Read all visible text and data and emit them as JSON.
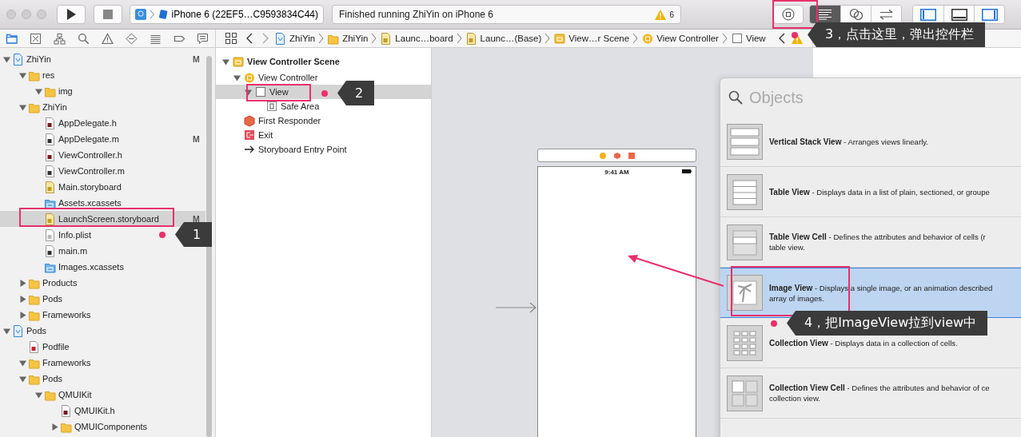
{
  "toolbar": {
    "scheme": "iPhone 6 (22EF5…C9593834C44)",
    "status": "Finished running ZhiYin on iPhone 6",
    "warning_count": "6",
    "editor_modes": [
      {
        "kind": "standard",
        "selected": true
      },
      {
        "kind": "assistant",
        "selected": false
      },
      {
        "kind": "version",
        "selected": false
      }
    ],
    "panels": [
      {
        "kind": "navigator",
        "on": true
      },
      {
        "kind": "debug",
        "on": false
      },
      {
        "kind": "inspector",
        "on": true
      }
    ]
  },
  "navigator_tabs": [
    {
      "kind": "project",
      "selected": true
    },
    {
      "kind": "symbol",
      "selected": false
    },
    {
      "kind": "hierarchy",
      "selected": false
    },
    {
      "kind": "search",
      "selected": false
    },
    {
      "kind": "issue",
      "selected": false
    },
    {
      "kind": "test",
      "selected": false
    },
    {
      "kind": "debug",
      "selected": false
    },
    {
      "kind": "breakpoint",
      "selected": false
    },
    {
      "kind": "report",
      "selected": false
    }
  ],
  "jump_bar": [
    {
      "kind": "project",
      "label": "ZhiYin"
    },
    {
      "kind": "folder",
      "label": "ZhiYin"
    },
    {
      "kind": "storyboard",
      "label": "Launc…board"
    },
    {
      "kind": "storyboard",
      "label": "Launc…(Base)"
    },
    {
      "kind": "scene",
      "label": "View…r Scene"
    },
    {
      "kind": "controller",
      "label": "View Controller"
    },
    {
      "kind": "view",
      "label": "View"
    }
  ],
  "navigator": {
    "tree": [
      {
        "kind": "project",
        "name": "ZhiYin",
        "badge": "M",
        "selected": false,
        "expanded": true,
        "children": [
          {
            "kind": "folder",
            "name": "res",
            "selected": false,
            "expanded": true,
            "children": [
              {
                "kind": "folder",
                "name": "img",
                "selected": false,
                "expanded": true
              }
            ]
          },
          {
            "kind": "folder",
            "name": "ZhiYin",
            "selected": false,
            "expanded": true,
            "children": [
              {
                "kind": "header",
                "name": "AppDelegate.h",
                "selected": false
              },
              {
                "kind": "source",
                "name": "AppDelegate.m",
                "badge": "M",
                "selected": false
              },
              {
                "kind": "header",
                "name": "ViewController.h",
                "selected": false
              },
              {
                "kind": "source",
                "name": "ViewController.m",
                "selected": false
              },
              {
                "kind": "storyboard",
                "name": "Main.storyboard",
                "selected": false
              },
              {
                "kind": "assets",
                "name": "Assets.xcassets",
                "selected": false
              },
              {
                "kind": "storyboard",
                "name": "LaunchScreen.storyboard",
                "badge": "M",
                "selected": true
              },
              {
                "kind": "plist",
                "name": "Info.plist",
                "selected": false
              },
              {
                "kind": "source",
                "name": "main.m",
                "selected": false
              },
              {
                "kind": "assets",
                "name": "Images.xcassets",
                "selected": false
              }
            ]
          },
          {
            "kind": "folder",
            "name": "Products",
            "selected": false,
            "expanded": false
          },
          {
            "kind": "folder",
            "name": "Pods",
            "selected": false,
            "expanded": false
          },
          {
            "kind": "folder",
            "name": "Frameworks",
            "selected": false,
            "expanded": false
          }
        ]
      },
      {
        "kind": "project",
        "name": "Pods",
        "selected": false,
        "expanded": true,
        "children": [
          {
            "kind": "ruby",
            "name": "Podfile",
            "selected": false
          },
          {
            "kind": "folder",
            "name": "Frameworks",
            "selected": false,
            "expanded": true
          },
          {
            "kind": "folder",
            "name": "Pods",
            "selected": false,
            "expanded": true,
            "children": [
              {
                "kind": "folder",
                "name": "QMUIKit",
                "selected": false,
                "expanded": true,
                "children": [
                  {
                    "kind": "header",
                    "name": "QMUIKit.h",
                    "selected": false
                  },
                  {
                    "kind": "folder",
                    "name": "QMUIComponents",
                    "selected": false,
                    "expanded": false
                  }
                ]
              }
            ]
          }
        ]
      }
    ]
  },
  "outline": {
    "tree": [
      {
        "kind": "scene",
        "name": "View Controller Scene",
        "selected": false,
        "expanded": true,
        "children": [
          {
            "kind": "controller",
            "name": "View Controller",
            "selected": false,
            "expanded": true,
            "children": [
              {
                "kind": "view",
                "name": "View",
                "selected": true,
                "expanded": true,
                "children": [
                  {
                    "kind": "safe-area",
                    "name": "Safe Area",
                    "selected": false
                  }
                ]
              }
            ]
          },
          {
            "kind": "responder",
            "name": "First Responder",
            "selected": false
          },
          {
            "kind": "exit",
            "name": "Exit",
            "selected": false
          },
          {
            "kind": "entry",
            "name": "Storyboard Entry Point",
            "selected": false
          }
        ]
      }
    ]
  },
  "canvas": {
    "status_time": "9:41 AM"
  },
  "library": {
    "placeholder": "Objects",
    "items": [
      {
        "kind": "stack",
        "selected": false,
        "lines": [
          "**Vertical Stack View** - Arranges views linearly."
        ]
      },
      {
        "kind": "table",
        "selected": false,
        "lines": [
          "**Table View** - Displays data in a list of plain, sectioned, or groupe"
        ]
      },
      {
        "kind": "table-cell",
        "selected": false,
        "lines": [
          "**Table View Cell** - Defines the attributes and behavior of cells (r",
          "table view."
        ]
      },
      {
        "kind": "image",
        "selected": true,
        "lines": [
          "**Image View** - Displays a single image, or an animation described",
          "array of images."
        ]
      },
      {
        "kind": "collection",
        "selected": false,
        "lines": [
          "**Collection View** - Displays data in a collection of cells."
        ]
      },
      {
        "kind": "collection-cell",
        "selected": false,
        "lines": [
          "**Collection View Cell** - Defines the attributes and behavior of ce",
          "collection view."
        ]
      }
    ]
  },
  "annotations": [
    {
      "label": "1"
    },
    {
      "label": "2"
    },
    {
      "label": "3，点击这里，弹出控件栏"
    },
    {
      "label": "4，把ImageView拉到view中"
    }
  ]
}
